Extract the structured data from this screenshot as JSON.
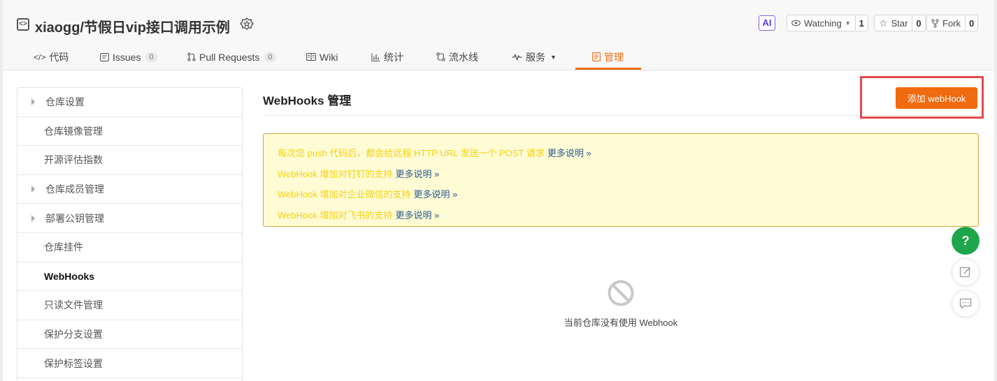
{
  "repo": {
    "owner": "xiaogg",
    "separator": "/",
    "name": "节假日vip接口调用示例"
  },
  "header_actions": {
    "ai_label": "AI",
    "watching_label": "Watching",
    "watching_count": "1",
    "star_label": "Star",
    "star_count": "0",
    "fork_label": "Fork",
    "fork_count": "0"
  },
  "tabs": [
    {
      "label": "代码"
    },
    {
      "label": "Issues",
      "count": "0"
    },
    {
      "label": "Pull Requests",
      "count": "0"
    },
    {
      "label": "Wiki"
    },
    {
      "label": "统计"
    },
    {
      "label": "流水线"
    },
    {
      "label": "服务"
    },
    {
      "label": "管理"
    }
  ],
  "active_tab": "管理",
  "sidebar": {
    "items": [
      {
        "label": "仓库设置",
        "arrow": true
      },
      {
        "label": "仓库镜像管理"
      },
      {
        "label": "开源评估指数"
      },
      {
        "label": "仓库成员管理",
        "arrow": true
      },
      {
        "label": "部署公钥管理",
        "arrow": true
      },
      {
        "label": "仓库挂件"
      },
      {
        "label": "WebHooks",
        "active": true
      },
      {
        "label": "只读文件管理"
      },
      {
        "label": "保护分支设置"
      },
      {
        "label": "保护标签设置"
      }
    ]
  },
  "main": {
    "title": "WebHooks 管理",
    "add_button": "添加 webHook",
    "notices": [
      {
        "text": "每次您 push 代码后，都会给远程 HTTP URL 发送一个 POST 请求",
        "more": "更多说明 »"
      },
      {
        "text": "WebHook 增加对钉钉的支持",
        "more": "更多说明 »"
      },
      {
        "text": "WebHook 增加对企业微信的支持",
        "more": "更多说明 »"
      },
      {
        "text": "WebHook 增加对飞书的支持",
        "more": "更多说明 »"
      }
    ],
    "empty_text": "当前仓库没有使用 Webhook"
  },
  "floating": {
    "help_label": "?"
  },
  "colors": {
    "accent": "#f06a0f",
    "notice_bg": "#fffbd4",
    "notice_text": "#f5d20f",
    "help_green": "#1ea64a",
    "highlight_red": "#e5484d"
  }
}
